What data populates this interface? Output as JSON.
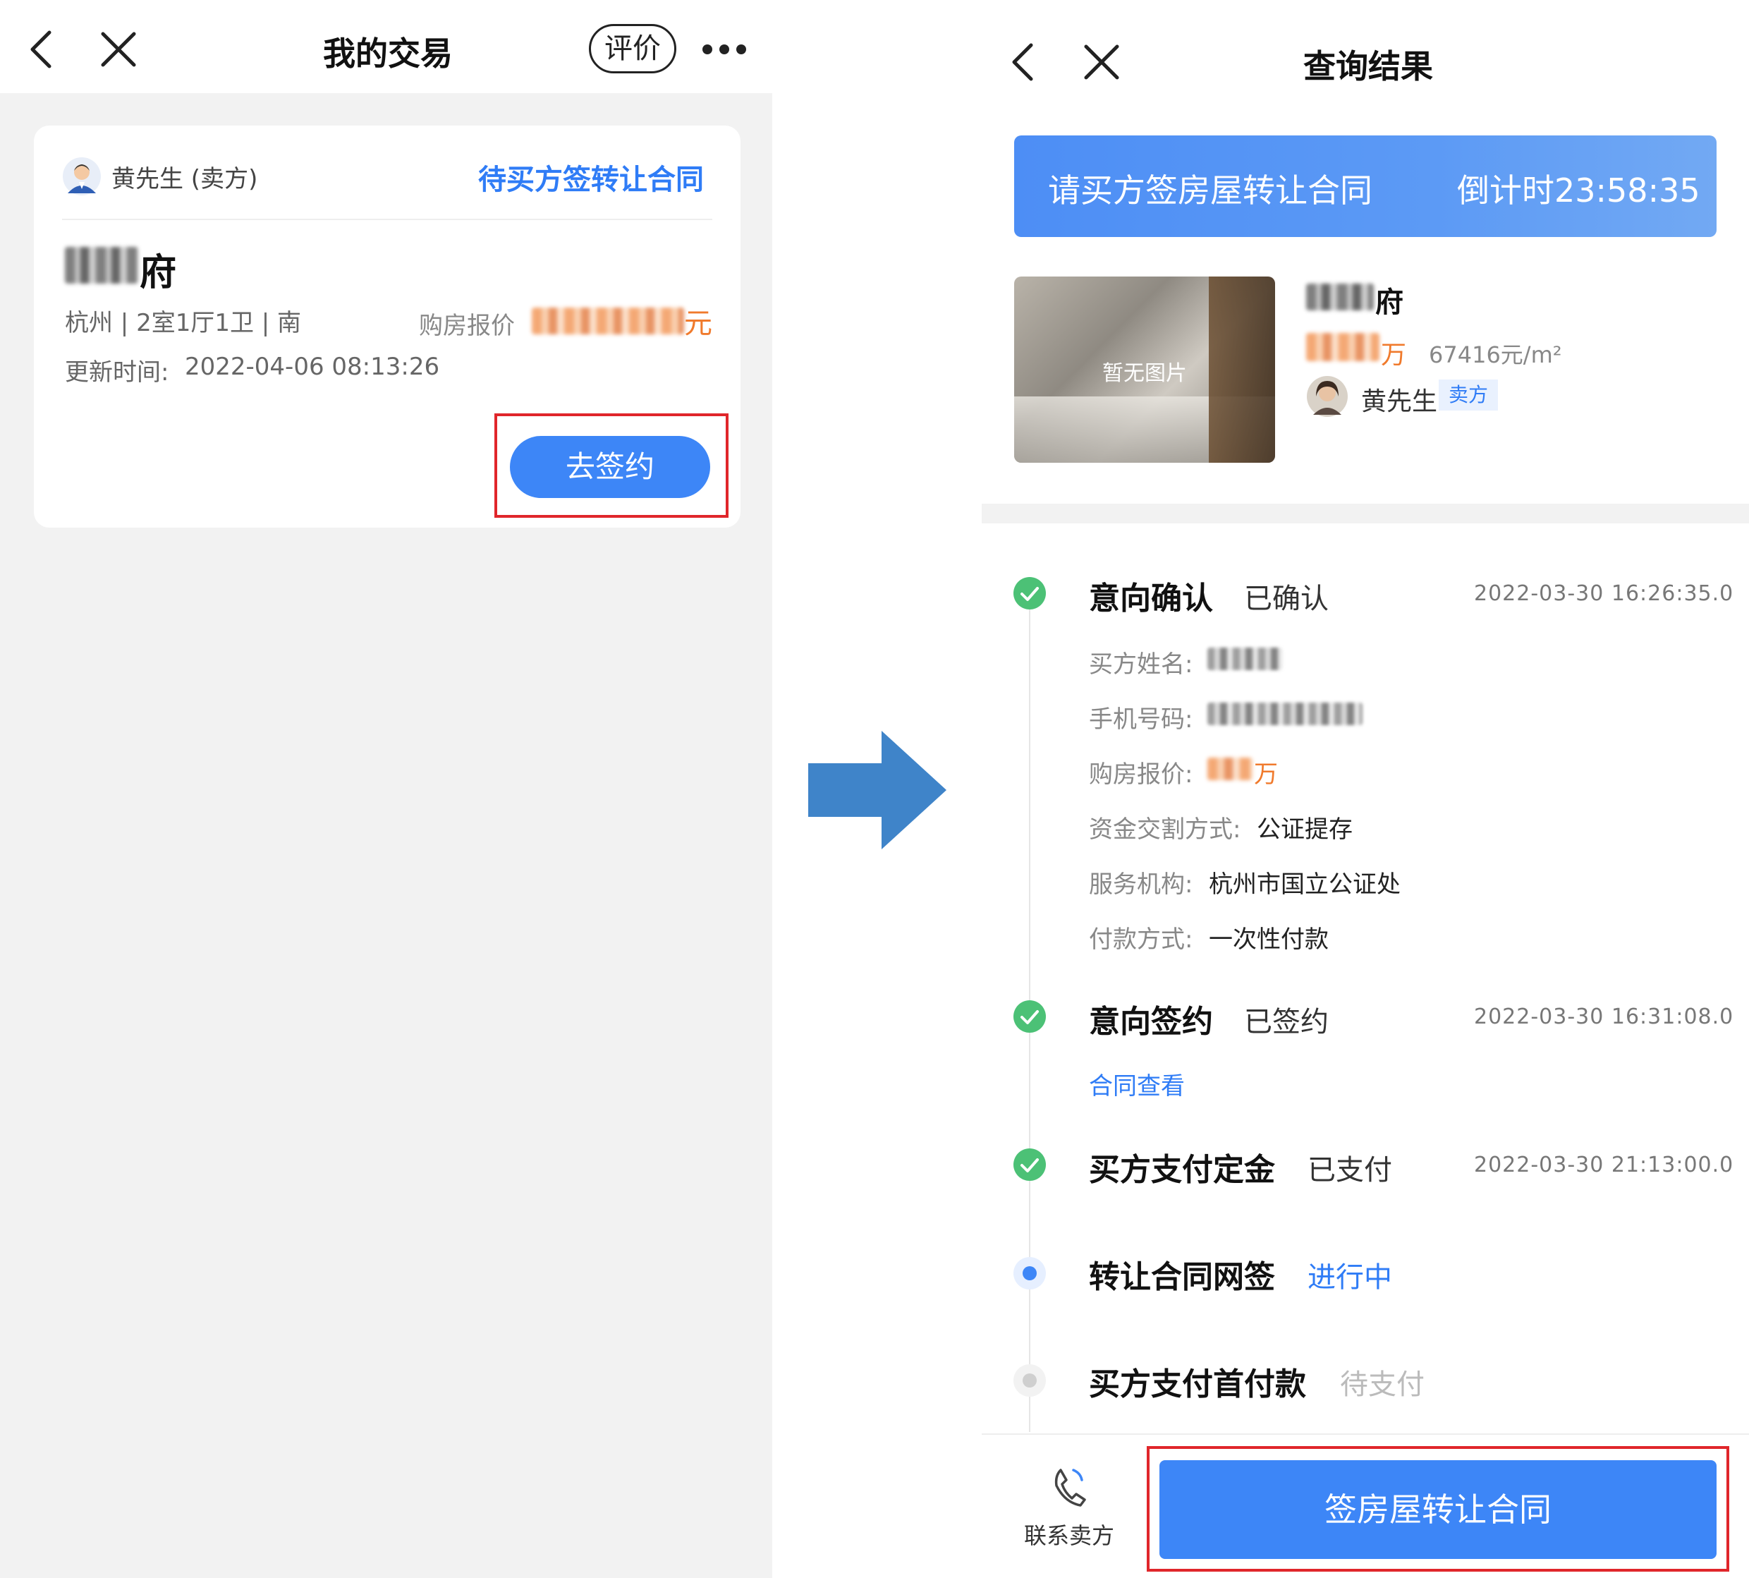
{
  "left": {
    "nav": {
      "title": "我的交易",
      "review_label": "评价"
    },
    "card": {
      "seller": "黄先生 (卖方)",
      "status": "待买方签转让合同",
      "property_suffix": "府",
      "details": "杭州 | 2室1厅1卫 | 南",
      "offer_label": "购房报价",
      "offer_unit": "元",
      "update_label": "更新时间:",
      "update_time": "2022-04-06 08:13:26",
      "sign_button": "去签约"
    }
  },
  "right": {
    "nav": {
      "title": "查询结果"
    },
    "banner": {
      "text": "请买方签房屋转让合同",
      "countdown": "倒计时23:58:35"
    },
    "listing": {
      "image_placeholder": "暂无图片",
      "name_suffix": "府",
      "price_unit": "万",
      "unit_price": "67416元/m²",
      "seller_name": "黄先生",
      "seller_tag": "卖方"
    },
    "steps": [
      {
        "title": "意向确认",
        "status": "已确认",
        "time": "2022-03-30 16:26:35.0"
      },
      {
        "title": "意向签约",
        "status": "已签约",
        "time": "2022-03-30 16:31:08.0",
        "link": "合同查看"
      },
      {
        "title": "买方支付定金",
        "status": "已支付",
        "time": "2022-03-30 21:13:00.0"
      },
      {
        "title": "转让合同网签",
        "status": "进行中"
      },
      {
        "title": "买方支付首付款",
        "status": "待支付"
      }
    ],
    "details": {
      "buyer_name_label": "买方姓名:",
      "phone_label": "手机号码:",
      "offer_label": "购房报价:",
      "offer_unit": "万",
      "fund_label": "资金交割方式:",
      "fund_value": "公证提存",
      "org_label": "服务机构:",
      "org_value": "杭州市国立公证处",
      "pay_label": "付款方式:",
      "pay_value": "一次性付款"
    },
    "bottom": {
      "contact_label": "联系卖方",
      "sign_button": "签房屋转让合同"
    }
  },
  "colors": {
    "accent": "#3d86f7",
    "success": "#4cc176",
    "highlight_box": "#e0262b",
    "price": "#f07a2c",
    "arrow": "#3f84c9"
  }
}
